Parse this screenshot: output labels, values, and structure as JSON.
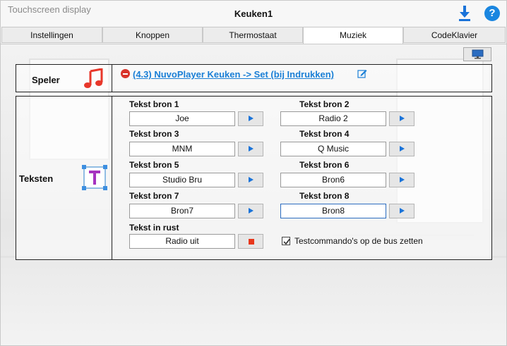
{
  "window": {
    "title": "Touchscreen display"
  },
  "header": {
    "title": "Keuken1",
    "download_icon": "download-icon",
    "help_icon": "help-icon",
    "help_label": "?"
  },
  "tabs": [
    {
      "label": "Instellingen",
      "active": false
    },
    {
      "label": "Knoppen",
      "active": false
    },
    {
      "label": "Thermostaat",
      "active": false
    },
    {
      "label": "Muziek",
      "active": true
    },
    {
      "label": "CodeKlavier",
      "active": false
    }
  ],
  "toolbar": {
    "monitor_icon": "monitor-icon"
  },
  "speler": {
    "label": "Speler",
    "icon": "music-note-icon",
    "action_link": "(4.3) NuvoPlayer Keuken -> Set  (bij Indrukken)",
    "remove_icon": "remove-icon",
    "edit_icon": "edit-icon"
  },
  "teksten": {
    "label": "Teksten",
    "icon": "text-tool-icon",
    "sources": [
      {
        "label": "Tekst bron 1",
        "value": "Joe"
      },
      {
        "label": "Tekst bron 2",
        "value": "Radio 2"
      },
      {
        "label": "Tekst bron 3",
        "value": "MNM"
      },
      {
        "label": "Tekst bron 4",
        "value": "Q Music"
      },
      {
        "label": "Tekst bron 5",
        "value": "Studio Bru"
      },
      {
        "label": "Tekst bron 6",
        "value": "Bron6"
      },
      {
        "label": "Tekst bron 7",
        "value": "Bron7"
      },
      {
        "label": "Tekst bron 8",
        "value": "Bron8"
      }
    ],
    "rest": {
      "label": "Tekst in rust",
      "value": "Radio uit"
    },
    "test_checkbox": {
      "label": "Testcommando's op de bus zetten",
      "checked": true
    }
  },
  "colors": {
    "accent": "#1a7fd6",
    "remove": "#d9342b",
    "stop": "#e8371b",
    "music": "#e8372a",
    "t_icon": "#a633c0"
  }
}
